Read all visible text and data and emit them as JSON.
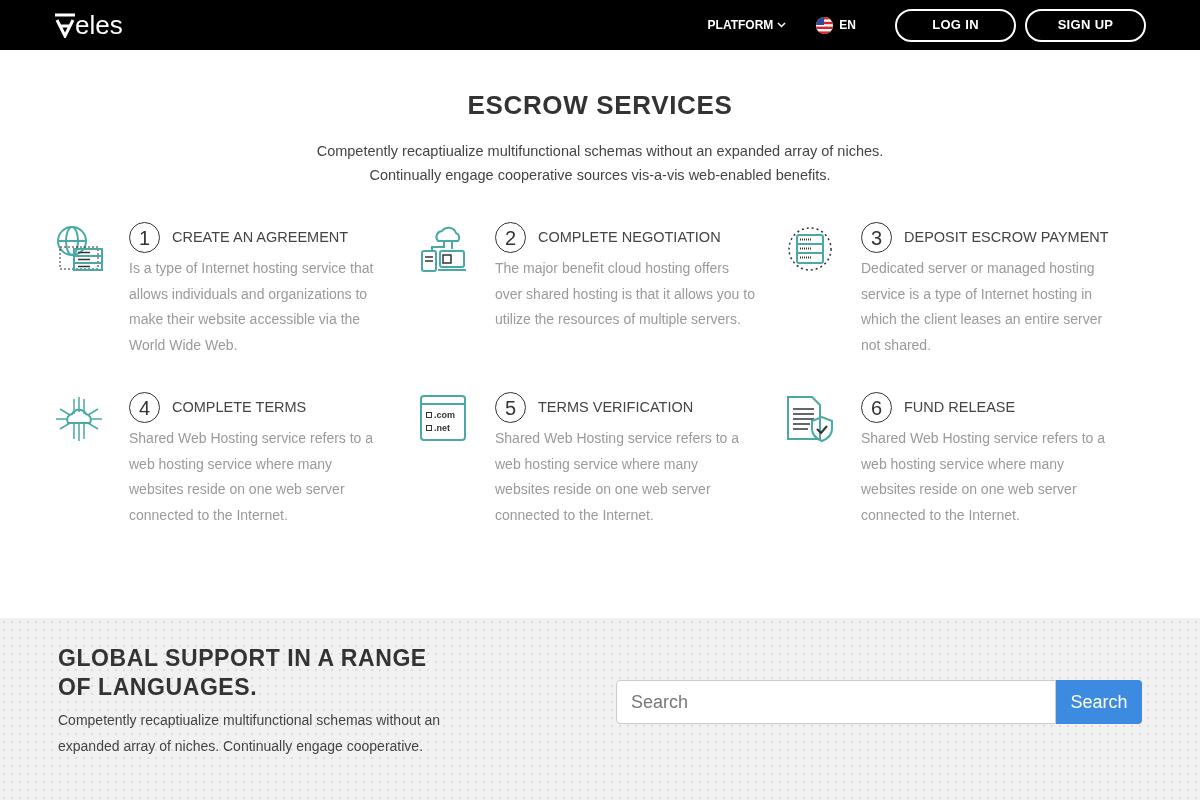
{
  "header": {
    "logo": "eles",
    "nav": [
      {
        "label": "PLATFORM",
        "kind": "dropdown"
      },
      {
        "label": "EN",
        "kind": "language"
      }
    ],
    "buttons": [
      "LOG IN",
      "SIGN UP"
    ]
  },
  "escrow": {
    "title": "ESCROW SERVICES",
    "subtitle_lines": [
      "Competently recaptiualize multifunctional schemas without an expanded array of niches.",
      "Continually engage cooperative sources vis-a-vis web-enabled benefits."
    ],
    "steps": [
      {
        "kind": "globe-server",
        "number": "1",
        "title": "CREATE AN AGREEMENT",
        "text": "Is a type of Internet hosting service that allows individuals and organizations to make their website accessible via the World Wide Web."
      },
      {
        "kind": "cloud-devices",
        "number": "2",
        "title": "COMPLETE NEGOTIATION",
        "text": "The major benefit cloud hosting offers over shared hosting is that it allows you to utilize the resources of multiple servers."
      },
      {
        "kind": "server-sync",
        "number": "3",
        "title": "DEPOSIT ESCROW PAYMENT",
        "text": "Dedicated server or managed hosting service is a type of Internet hosting in which the client leases an entire server not shared."
      },
      {
        "kind": "cloud-circuit",
        "number": "4",
        "title": "COMPLETE TERMS",
        "text": "Shared Web Hosting service refers to a web hosting service where many websites reside on one web server connected to the Internet."
      },
      {
        "kind": "domains",
        "icon_labels": [
          ".com",
          ".net"
        ],
        "number": "5",
        "title": "TERMS VERIFICATION",
        "text": "Shared Web Hosting service refers to a web hosting service where many websites reside on one web server connected to the Internet."
      },
      {
        "kind": "document-shield",
        "number": "6",
        "title": "FUND RELEASE",
        "text": "Shared Web Hosting service refers to a web hosting service where many websites reside on one web server connected to the Internet."
      }
    ]
  },
  "support": {
    "title": "GLOBAL SUPPORT IN A RANGE OF LANGUAGES.",
    "text": "Competently recaptiualize multifunctional schemas without an expanded array of niches. Continually engage cooperative.",
    "search": {
      "placeholder": "Search",
      "button": "Search"
    }
  }
}
